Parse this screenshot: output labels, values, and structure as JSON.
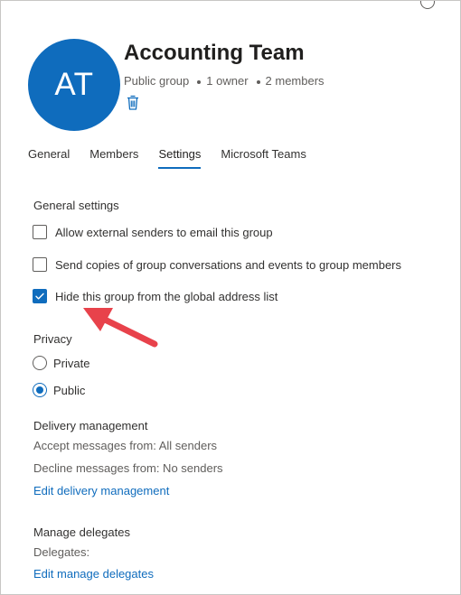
{
  "group": {
    "initials": "AT",
    "name": "Accounting Team",
    "type": "Public group",
    "owners": "1 owner",
    "members": "2 members"
  },
  "tabs": [
    {
      "label": "General",
      "active": false
    },
    {
      "label": "Members",
      "active": false
    },
    {
      "label": "Settings",
      "active": true
    },
    {
      "label": "Microsoft Teams",
      "active": false
    }
  ],
  "general_settings": {
    "heading": "General settings",
    "options": [
      {
        "label": "Allow external senders to email this group",
        "checked": false
      },
      {
        "label": "Send copies of group conversations and events to group members",
        "checked": false
      },
      {
        "label": "Hide this group from the global address list",
        "checked": true
      }
    ]
  },
  "privacy": {
    "heading": "Privacy",
    "options": [
      {
        "label": "Private",
        "selected": false
      },
      {
        "label": "Public",
        "selected": true
      }
    ]
  },
  "delivery": {
    "heading": "Delivery management",
    "accept": "Accept messages from: All senders",
    "decline": "Decline messages from: No senders",
    "edit_link": "Edit delivery management"
  },
  "delegates": {
    "heading": "Manage delegates",
    "label": "Delegates:",
    "edit_link": "Edit manage delegates"
  },
  "colors": {
    "accent": "#0f6cbd",
    "annotation_arrow": "#e8424b"
  },
  "icons": {
    "delete": "trash-icon",
    "check": "checkmark-icon",
    "annotation": "red-arrow-annotation"
  }
}
